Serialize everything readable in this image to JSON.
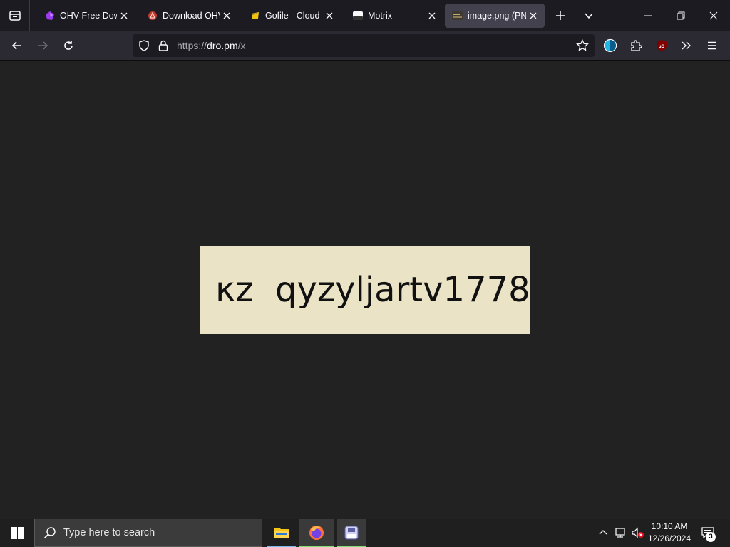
{
  "browser": {
    "tabs": [
      {
        "title": "OHV Free Down",
        "favicon": "ohv-logo-icon",
        "active": false
      },
      {
        "title": "Download OHV",
        "favicon": "red-circle-logo-icon",
        "active": false
      },
      {
        "title": "Gofile - Cloud St",
        "favicon": "gofile-logo-icon",
        "active": false
      },
      {
        "title": "Motrix",
        "favicon": "motrix-logo-icon",
        "active": false
      },
      {
        "title": "image.png (PNG",
        "favicon": "image-thumbnail-icon",
        "active": true
      }
    ],
    "url": {
      "scheme": "https://",
      "host": "dro.pm",
      "path": "/x"
    }
  },
  "content": {
    "image_text": "κz  qyzyljartv1778"
  },
  "taskbar": {
    "search_placeholder": "Type here to search",
    "time": "10:10 AM",
    "date": "12/26/2024",
    "notification_count": "3"
  },
  "colors": {
    "tabstrip_bg": "#1c1b22",
    "navbar_bg": "#2b2a33",
    "content_bg": "#222222",
    "image_bg": "#ebe3c6",
    "taskbar_bg": "#1f1f1f"
  }
}
